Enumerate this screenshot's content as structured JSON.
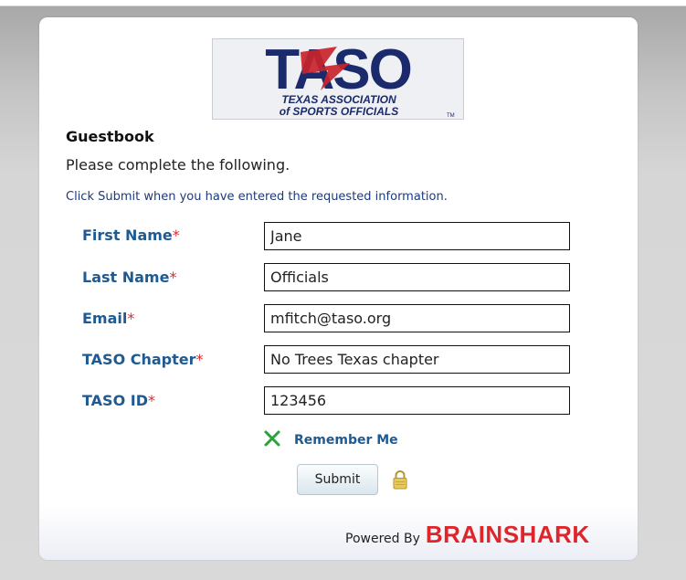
{
  "logo": {
    "letters": "TASO",
    "line1": "TEXAS ASSOCIATION",
    "line2": "of SPORTS OFFICIALS",
    "tm": "TM"
  },
  "form": {
    "title": "Guestbook",
    "subtitle": "Please complete the following.",
    "instruction": "Click Submit when you have entered the requested information.",
    "required_marker": "*",
    "fields": [
      {
        "label": "First Name",
        "value": "Jane"
      },
      {
        "label": "Last Name",
        "value": "Officials"
      },
      {
        "label": "Email",
        "value": "mfitch@taso.org"
      },
      {
        "label": "TASO Chapter",
        "value": "No Trees Texas chapter"
      },
      {
        "label": "TASO ID",
        "value": "123456"
      }
    ],
    "remember_me": {
      "label": "Remember Me",
      "checked": true,
      "icon": "x-checkmark-icon"
    },
    "submit_label": "Submit",
    "lock_icon": "padlock-icon"
  },
  "footer": {
    "powered_by": "Powered By",
    "brand": "BRAINSHARK"
  },
  "colors": {
    "label_blue": "#1f5a92",
    "required_red": "#d22f2f",
    "brand_red": "#e0252a",
    "logo_navy": "#1a2a6b",
    "logo_red": "#c8242b",
    "check_green": "#2aa23a",
    "lock_gold": "#d9b84a"
  }
}
